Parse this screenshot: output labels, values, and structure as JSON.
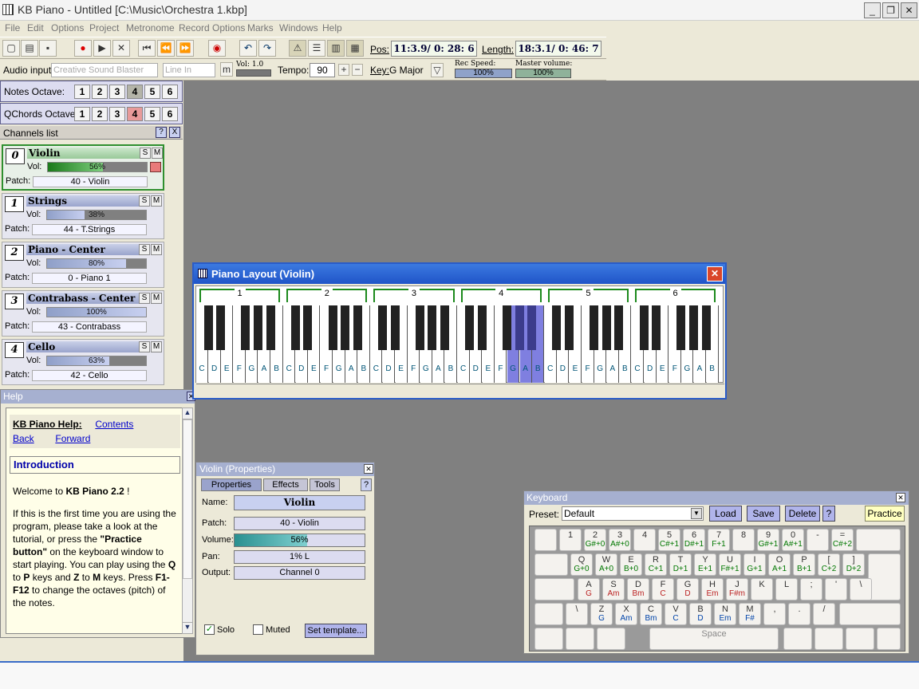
{
  "window": {
    "title": "KB Piano - Untitled [C:\\Music\\Orchestra 1.kbp]",
    "min": "_",
    "restore": "❐",
    "close": "✕"
  },
  "menu": [
    "File",
    "Edit",
    "Options",
    "Project",
    "Metronome",
    "Record Options",
    "Marks",
    "Windows",
    "Help"
  ],
  "toolbar": {
    "pos_label": "Pos:",
    "pos_value": "11:3.9/ 0: 28: 6",
    "length_label": "Length:",
    "length_value": "18:3.1/ 0: 46: 7"
  },
  "toolbar2": {
    "audio_input_label": "Audio input:",
    "audio_device": "Creative Sound Blaster",
    "audio_line": "Line In",
    "m_button": "m",
    "vol_label": "Vol: 1.0",
    "tempo_label": "Tempo:",
    "tempo_value": "90",
    "plus": "+",
    "minus": "−",
    "key_label": "Key:",
    "key_value": "G Major",
    "rec_speed_label": "Rec Speed:",
    "rec_speed_value": "100%",
    "master_volume_label": "Master volume:",
    "master_volume_value": "100%"
  },
  "notes_octave": {
    "label": "Notes Octave:",
    "values": [
      "1",
      "2",
      "3",
      "4",
      "5",
      "6"
    ],
    "selected": "4"
  },
  "qchords_octave": {
    "label": "QChords Octave:",
    "values": [
      "1",
      "2",
      "3",
      "4",
      "5",
      "6"
    ],
    "selected": "4"
  },
  "channels_list": {
    "title": "Channels list",
    "help": "?",
    "close": "X"
  },
  "channels": [
    {
      "num": "0",
      "name": "Violin",
      "vol_label": "Vol:",
      "vol": "56%",
      "vol_value": 0.56,
      "patch_label": "Patch:",
      "patch": "40 - Violin",
      "solo": "S",
      "mute": "M",
      "active": true
    },
    {
      "num": "1",
      "name": "Strings",
      "vol_label": "Vol:",
      "vol": "38%",
      "vol_value": 0.38,
      "patch_label": "Patch:",
      "patch": "44 - T.Strings",
      "solo": "S",
      "mute": "M"
    },
    {
      "num": "2",
      "name": "Piano - Center",
      "vol_label": "Vol:",
      "vol": "80%",
      "vol_value": 0.8,
      "patch_label": "Patch:",
      "patch": "0 - Piano 1",
      "solo": "S",
      "mute": "M"
    },
    {
      "num": "3",
      "name": "Contrabass - Center",
      "vol_label": "Vol:",
      "vol": "100%",
      "vol_value": 1.0,
      "patch_label": "Patch:",
      "patch": "43 - Contrabass",
      "solo": "S",
      "mute": "M"
    },
    {
      "num": "4",
      "name": "Cello",
      "vol_label": "Vol:",
      "vol": "63%",
      "vol_value": 0.63,
      "patch_label": "Patch:",
      "patch": "42 - Cello",
      "solo": "S",
      "mute": "M"
    }
  ],
  "help": {
    "title": "Help",
    "heading": "KB Piano Help:",
    "contents": "Contents",
    "back": "Back",
    "forward": "Forward",
    "section": "Introduction",
    "p1a": "Welcome to ",
    "p1b": "KB Piano 2.2",
    "p1c": " !",
    "p2": "If this is the first time you are using the program, please take a look at the tutorial, or press the ",
    "p2b": "\"Practice button\"",
    "p2c": " on the keyboard window to start playing. You can play using the ",
    "q": "Q",
    "to": " to ",
    "p": "P",
    "and": " keys and ",
    "z": "Z",
    "to2": " to ",
    "m": "M",
    "keys": " keys. Press ",
    "f": "F1-F12",
    "p3": " to change the octaves (pitch) of the notes."
  },
  "piano_layout": {
    "title": "Piano Layout (Violin)",
    "close": "✕",
    "octaves": [
      "1",
      "2",
      "3",
      "4",
      "5",
      "6"
    ],
    "white_notes": [
      "C",
      "D",
      "E",
      "F",
      "G",
      "A",
      "B"
    ],
    "highlighted_octave": 4,
    "highlighted_notes": [
      "G",
      "A",
      "B"
    ]
  },
  "properties": {
    "title": "Violin (Properties)",
    "tabs": [
      "Properties",
      "Effects",
      "Tools"
    ],
    "help": "?",
    "name_label": "Name:",
    "name": "Violin",
    "patch_label": "Patch:",
    "patch": "40 - Violin",
    "volume_label": "Volume:",
    "volume": "56%",
    "volume_value": 0.56,
    "pan_label": "Pan:",
    "pan": "1% L",
    "output_label": "Output:",
    "output": "Channel 0",
    "solo_label": "Solo",
    "muted_label": "Muted",
    "set_template": "Set template..."
  },
  "keyboard": {
    "title": "Keyboard",
    "preset_label": "Preset:",
    "preset": "Default",
    "load": "Load",
    "save": "Save",
    "delete": "Delete",
    "help": "?",
    "practice": "Practice",
    "space": "Space",
    "row1": [
      [
        "",
        "",
        ""
      ],
      [
        "1",
        "",
        ""
      ],
      [
        "2",
        "G#+0",
        ""
      ],
      [
        "3",
        "A#+0",
        ""
      ],
      [
        "4",
        "",
        ""
      ],
      [
        "5",
        "C#+1",
        ""
      ],
      [
        "6",
        "D#+1",
        ""
      ],
      [
        "7",
        "F+1",
        ""
      ],
      [
        "8",
        "",
        ""
      ],
      [
        "9",
        "G#+1",
        ""
      ],
      [
        "0",
        "A#+1",
        ""
      ],
      [
        "-",
        "",
        ""
      ],
      [
        "=",
        "C#+2",
        ""
      ]
    ],
    "row2": [
      [
        "Q",
        "G+0",
        ""
      ],
      [
        "W",
        "A+0",
        ""
      ],
      [
        "E",
        "B+0",
        ""
      ],
      [
        "R",
        "C+1",
        ""
      ],
      [
        "T",
        "D+1",
        ""
      ],
      [
        "Y",
        "E+1",
        ""
      ],
      [
        "U",
        "F#+1",
        ""
      ],
      [
        "I",
        "G+1",
        ""
      ],
      [
        "O",
        "A+1",
        ""
      ],
      [
        "P",
        "B+1",
        ""
      ],
      [
        "[",
        "C+2",
        ""
      ],
      [
        "]",
        "D+2",
        ""
      ]
    ],
    "row3": [
      [
        "A",
        "G",
        ""
      ],
      [
        "S",
        "Am",
        ""
      ],
      [
        "D",
        "Bm",
        ""
      ],
      [
        "F",
        "C",
        ""
      ],
      [
        "G",
        "D",
        ""
      ],
      [
        "H",
        "Em",
        ""
      ],
      [
        "J",
        "F#m",
        ""
      ],
      [
        "K",
        "",
        ""
      ],
      [
        "L",
        "",
        ""
      ],
      [
        ";",
        "",
        ""
      ],
      [
        "'",
        "",
        ""
      ],
      [
        "\\",
        "",
        ""
      ]
    ],
    "row4": [
      [
        "\\",
        "",
        ""
      ],
      [
        "Z",
        "G",
        ""
      ],
      [
        "X",
        "Am",
        ""
      ],
      [
        "C",
        "Bm",
        ""
      ],
      [
        "V",
        "C",
        ""
      ],
      [
        "B",
        "D",
        ""
      ],
      [
        "N",
        "Em",
        ""
      ],
      [
        "M",
        "F#",
        ""
      ],
      [
        ",",
        "",
        ""
      ],
      [
        ".",
        "",
        ""
      ],
      [
        "/",
        "",
        ""
      ]
    ]
  }
}
